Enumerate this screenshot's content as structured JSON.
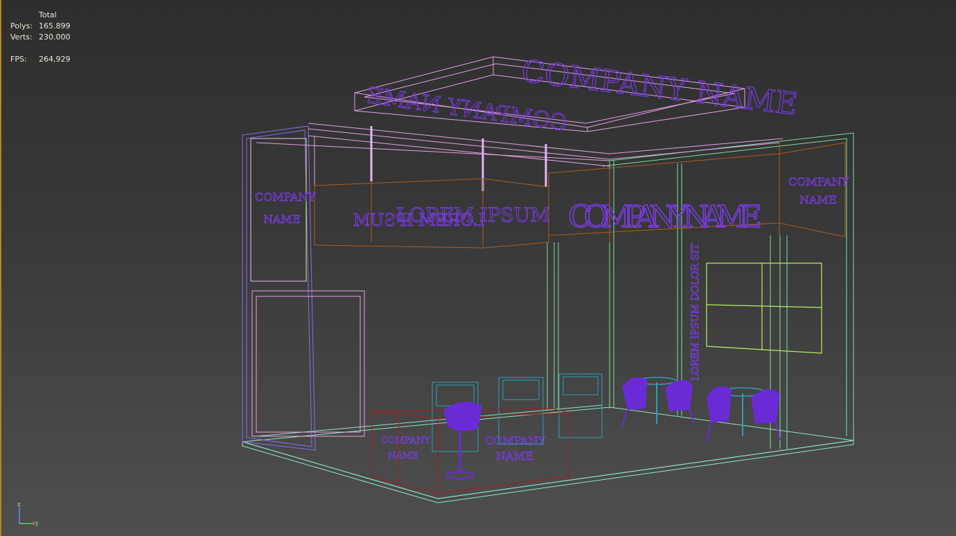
{
  "stats": {
    "header": "Total",
    "polys_label": "Polys:",
    "polys_value": "165.899",
    "verts_label": "Verts:",
    "verts_value": "230.000",
    "fps_label": "FPS:",
    "fps_value": "264,929"
  },
  "signage": {
    "top_company": "COMPANY NAME",
    "top_company_mirror": "COMPANY NAME",
    "header_lorem": "LOREM IPSUM",
    "header_lorem_mirror": "LOREM IPSUM",
    "right_company": "COMPANY NAME",
    "tower_company_line1": "COMPANY",
    "tower_company_line2": "NAME",
    "panel_company_line1": "COMPANY",
    "panel_company_line2": "NAME",
    "vertical_text": "LOREM IPSUM DOLOR SIT",
    "counter_company_line1": "COMPANY",
    "counter_company_line2": "NAME",
    "counter_side_line1": "COMPANY",
    "counter_side_line2": "NAME"
  },
  "axis": {
    "z": "z",
    "x": "x",
    "y": "y"
  },
  "colors": {
    "viewport_border": "#b08a1e",
    "pink": "#e8a0e8",
    "purple": "#6a2bd6",
    "orange": "#b05a1a",
    "green": "#7fe0a0",
    "lime": "#b6f060",
    "cyan": "#2aa0b8",
    "red": "#b01a1a"
  }
}
